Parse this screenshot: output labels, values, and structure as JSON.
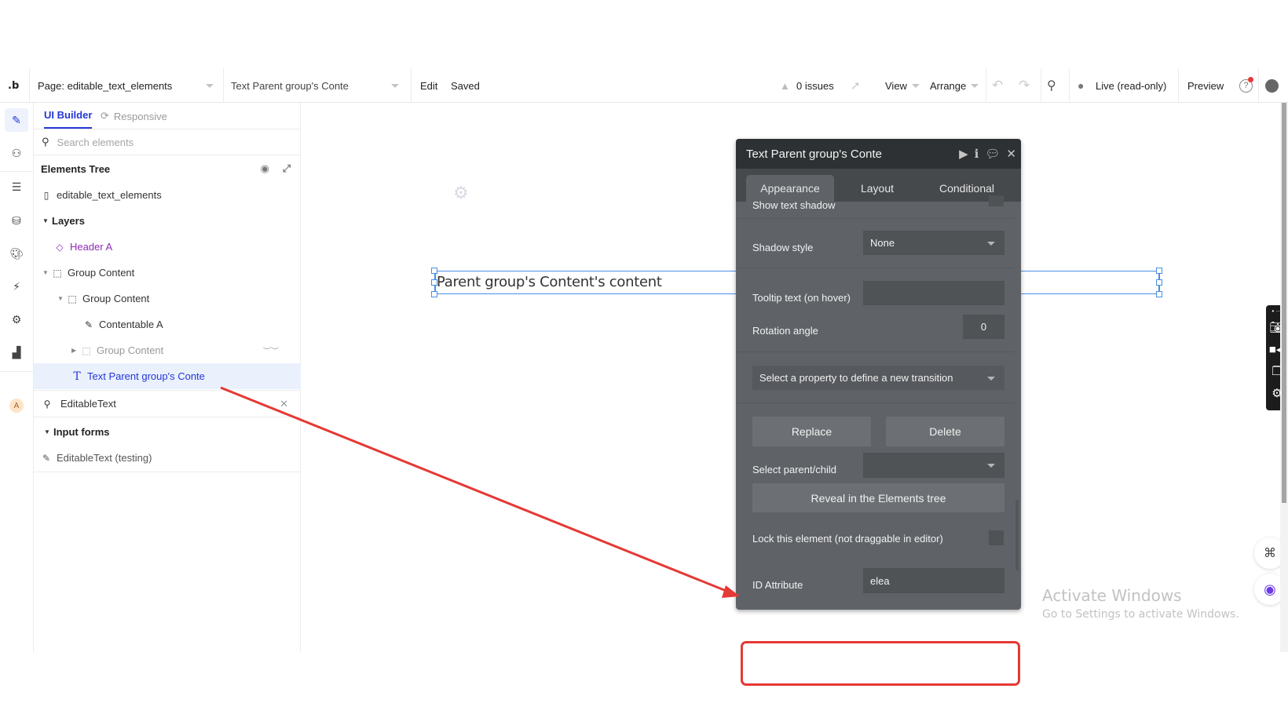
{
  "topbar": {
    "logo": ".b",
    "page_selector": "Page: editable_text_elements",
    "element_selector": "Text Parent group's Conte",
    "mode": "Edit",
    "save_status": "Saved",
    "issues": "0 issues",
    "view_menu": "View",
    "arrange_menu": "Arrange",
    "live_status": "Live (read-only)",
    "preview": "Preview",
    "notification_color": "#e53935"
  },
  "rail": {
    "items": [
      "design-pencil",
      "workflow-tree",
      "data-stack",
      "database",
      "styles-palette",
      "plugins",
      "settings",
      "logs-chart"
    ],
    "avatar": "A"
  },
  "panel": {
    "tabs": [
      {
        "label": "UI Builder",
        "active": true
      },
      {
        "label": "Responsive",
        "active": false
      }
    ],
    "search_placeholder": "Search elements",
    "tree_title": "Elements Tree",
    "tree": [
      {
        "label": "editable_text_elements",
        "icon": "page",
        "depth": 0
      },
      {
        "label": "Layers",
        "icon": "caret",
        "depth": 0
      },
      {
        "label": "Header A",
        "icon": "diamond",
        "depth": 1
      },
      {
        "label": "Group Content",
        "icon": "group",
        "depth": 1,
        "expanded": true
      },
      {
        "label": "Group Content",
        "icon": "group",
        "depth": 2,
        "expanded": true
      },
      {
        "label": "Contentable A",
        "icon": "pencil",
        "depth": 3
      },
      {
        "label": "Group Content",
        "icon": "group",
        "depth": 3,
        "hidden": true
      },
      {
        "label": "Text Parent group's Conte",
        "icon": "text",
        "depth": 2,
        "selected": true
      }
    ],
    "search2_value": "EditableText",
    "section_title": "Input forms",
    "section_items": [
      "EditableText (testing)"
    ]
  },
  "canvas": {
    "text_content": "Parent group's Content's content"
  },
  "editor": {
    "title": "Text Parent group's Conte",
    "tabs": [
      "Appearance",
      "Layout",
      "Conditional"
    ],
    "active_tab": "Appearance",
    "clipped_label": "Show text shadow",
    "shadow_style_label": "Shadow style",
    "shadow_style_value": "None",
    "tooltip_label": "Tooltip text (on hover)",
    "tooltip_value": "",
    "rotation_label": "Rotation angle",
    "rotation_value": "0",
    "transition_placeholder": "Select a property to define a new transition",
    "replace_button": "Replace",
    "delete_button": "Delete",
    "parent_child_label": "Select parent/child",
    "parent_child_value": "",
    "reveal_button": "Reveal in the Elements tree",
    "lock_label": "Lock this element (not draggable in editor)",
    "lock_checked": false,
    "id_attr_label": "ID Attribute",
    "id_attr_value": "elea"
  },
  "annotation": {
    "highlight_color": "#e53935"
  },
  "watermark": {
    "title": "Activate Windows",
    "subtitle": "Go to Settings to activate Windows."
  }
}
